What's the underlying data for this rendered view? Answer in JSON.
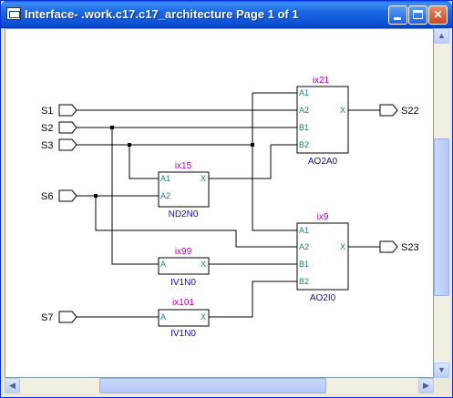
{
  "window": {
    "title": "Interface- .work.c17.c17_architecture Page 1 of 1"
  },
  "title_buttons": {
    "minimize": "",
    "maximize": "",
    "close": "✕"
  },
  "ports": {
    "inputs": [
      "S1",
      "S2",
      "S3",
      "S6",
      "S7"
    ],
    "outputs": [
      "S22",
      "S23"
    ]
  },
  "instances": {
    "ix21": {
      "name": "ix21",
      "cell": "AO2A0",
      "pins_in": [
        "A1",
        "A2",
        "B1",
        "B2"
      ],
      "pin_out": "X"
    },
    "ix15": {
      "name": "ix15",
      "cell": "ND2N0",
      "pins_in": [
        "A1",
        "A2"
      ],
      "pin_out": "X"
    },
    "ix9": {
      "name": "ix9",
      "cell": "AO2I0",
      "pins_in": [
        "A1",
        "A2",
        "B1",
        "B2"
      ],
      "pin_out": "X"
    },
    "ix99": {
      "name": "ix99",
      "cell": "IV1N0",
      "pins_in": [
        "A"
      ],
      "pin_out": "X"
    },
    "ix101": {
      "name": "ix101",
      "cell": "IV1N0",
      "pins_in": [
        "A"
      ],
      "pin_out": "X"
    }
  },
  "colors": {
    "instance_name": "#b000b0",
    "cell_name": "#1010a0",
    "pin_label": "#1a7a7a",
    "wire": "#000000",
    "title_text": "#ffffff"
  },
  "scrollbars": {
    "up_icon": "▲",
    "down_icon": "▼",
    "left_icon": "◀",
    "right_icon": "▶"
  }
}
